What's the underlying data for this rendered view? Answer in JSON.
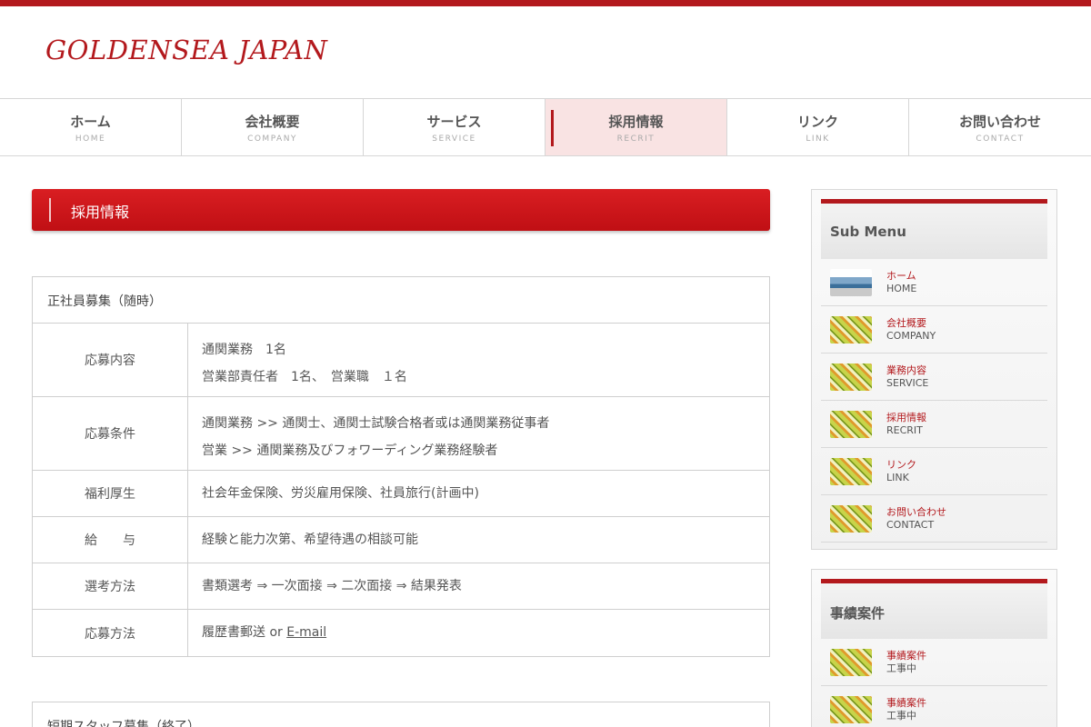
{
  "site": {
    "logo": "GOLDENSEA JAPAN"
  },
  "colors": {
    "accent": "#b3191d",
    "nav_active_bg": "#f9e3e3"
  },
  "nav": [
    {
      "jp": "ホーム",
      "en": "HOME"
    },
    {
      "jp": "会社概要",
      "en": "COMPANY"
    },
    {
      "jp": "サービス",
      "en": "SERVICE"
    },
    {
      "jp": "採用情報",
      "en": "RECRIT",
      "active": true
    },
    {
      "jp": "リンク",
      "en": "LINK"
    },
    {
      "jp": "お問い合わせ",
      "en": "CONTACT"
    }
  ],
  "page_title": "採用情報",
  "job_main": {
    "heading": "正社員募集（随時）",
    "rows": [
      {
        "label": "応募内容",
        "lines": [
          "通関業務　1名",
          "営業部責任者　1名、　営業職　１名"
        ]
      },
      {
        "label": "応募条件",
        "lines": [
          "通関業務 >> 通関士、通関士試験合格者或は通関業務従事者",
          "営業 >> 通関業務及びフォワーディング業務経験者"
        ]
      },
      {
        "label": "福利厚生",
        "lines": [
          "社会年金保険、労災雇用保険、社員旅行(計画中)"
        ]
      },
      {
        "label": "給　　与",
        "lines": [
          "経験と能力次第、希望待遇の相談可能"
        ]
      },
      {
        "label": "選考方法",
        "lines": [
          "書類選考 ⇒ 一次面接 ⇒ 二次面接 ⇒ 結果発表"
        ]
      },
      {
        "label": "応募方法",
        "prefix": "履歴書郵送 or ",
        "link": "E-mail"
      }
    ]
  },
  "job_second": {
    "heading": "短期スタッフ募集（終了）"
  },
  "sub_menu": {
    "heading": "Sub Menu",
    "items": [
      {
        "jp": "ホーム",
        "en": "HOME",
        "thumb": "photo"
      },
      {
        "jp": "会社概要",
        "en": "COMPANY",
        "thumb": "pattern"
      },
      {
        "jp": "業務内容",
        "en": "SERVICE",
        "thumb": "pattern"
      },
      {
        "jp": "採用情報",
        "en": "RECRIT",
        "thumb": "pattern"
      },
      {
        "jp": "リンク",
        "en": "LINK",
        "thumb": "pattern"
      },
      {
        "jp": "お問い合わせ",
        "en": "CONTACT",
        "thumb": "pattern"
      }
    ]
  },
  "cases": {
    "heading": "事績案件",
    "items": [
      {
        "jp": "事績案件",
        "en": "工事中",
        "thumb": "pattern"
      },
      {
        "jp": "事績案件",
        "en": "工事中",
        "thumb": "pattern"
      }
    ]
  }
}
